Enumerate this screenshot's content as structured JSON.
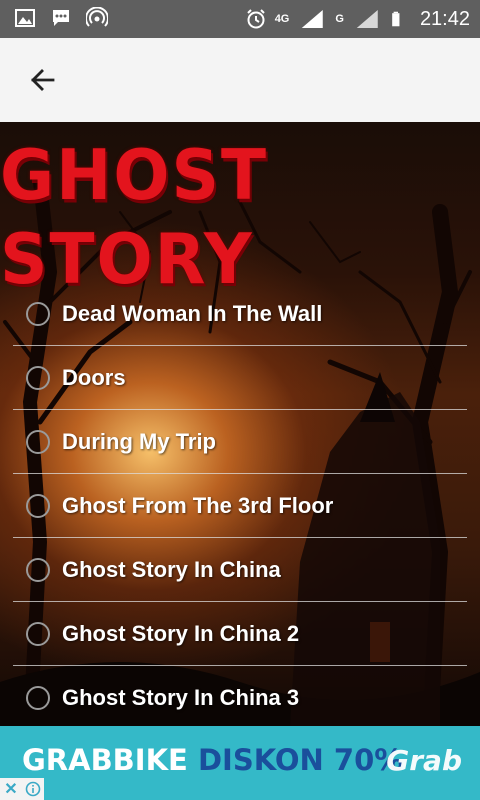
{
  "status_bar": {
    "time": "21:42",
    "network_a": "4G",
    "network_b": "G",
    "icons": [
      "image-icon",
      "chat-icon",
      "hotspot-icon",
      "alarm-icon",
      "signal-icon",
      "signal-icon",
      "battery-icon"
    ]
  },
  "app_bar": {
    "back_icon": "arrow-left-icon"
  },
  "title": "GHOST STORY",
  "stories": [
    {
      "label": "Dead Woman In The Wall"
    },
    {
      "label": "Doors"
    },
    {
      "label": "During My Trip"
    },
    {
      "label": "Ghost From The 3rd Floor"
    },
    {
      "label": "Ghost Story In China"
    },
    {
      "label": "Ghost Story In China 2"
    },
    {
      "label": "Ghost Story In China 3"
    }
  ],
  "ad": {
    "word1": "GRABBIKE",
    "word2": "DISKON 70%",
    "brand": "Grab",
    "controls": [
      "close-icon",
      "info-icon"
    ],
    "colors": {
      "background": "#34b9c8",
      "accent": "#1a4f9c"
    }
  },
  "colors": {
    "title_red": "#e3141d",
    "appbar": "#f4f4f4",
    "statusbar": "#5f5f5f"
  }
}
